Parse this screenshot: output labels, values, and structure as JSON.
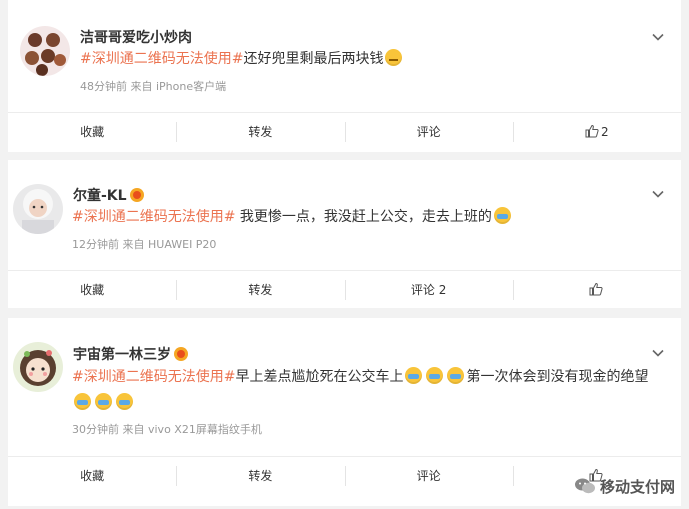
{
  "posts": [
    {
      "username": "洁哥哥爱吃小炒肉",
      "topic": "#深圳通二维码无法使用#",
      "text": "还好兜里剩最后两块钱",
      "meta": "48分钟前 来自 iPhone客户端",
      "actions": {
        "collect": "收藏",
        "repost": "转发",
        "comment": "评论",
        "like": "2"
      }
    },
    {
      "username": "尔童-KL",
      "topic": "#深圳通二维码无法使用#",
      "text": " 我更惨一点，我没赶上公交，走去上班的",
      "meta": "12分钟前 来自 HUAWEI P20",
      "actions": {
        "collect": "收藏",
        "repost": "转发",
        "comment": "评论 2",
        "like": ""
      }
    },
    {
      "username": "宇宙第一林三岁",
      "topic": "#深圳通二维码无法使用#",
      "text": "早上差点尴尬死在公交车上",
      "text2": "第一次体会到没有现金的绝望",
      "meta": "30分钟前 来自 vivo X21屏幕指纹手机",
      "actions": {
        "collect": "收藏",
        "repost": "转发",
        "comment": "评论",
        "like": ""
      }
    }
  ],
  "watermark": "移动支付网",
  "colors": {
    "topic": "#eb7350",
    "meta": "#999999",
    "background": "#f2f2f2"
  },
  "icons": [
    "chevron-down-icon",
    "thumbs-up-icon",
    "vip-crown-icon",
    "wechat-icon"
  ]
}
